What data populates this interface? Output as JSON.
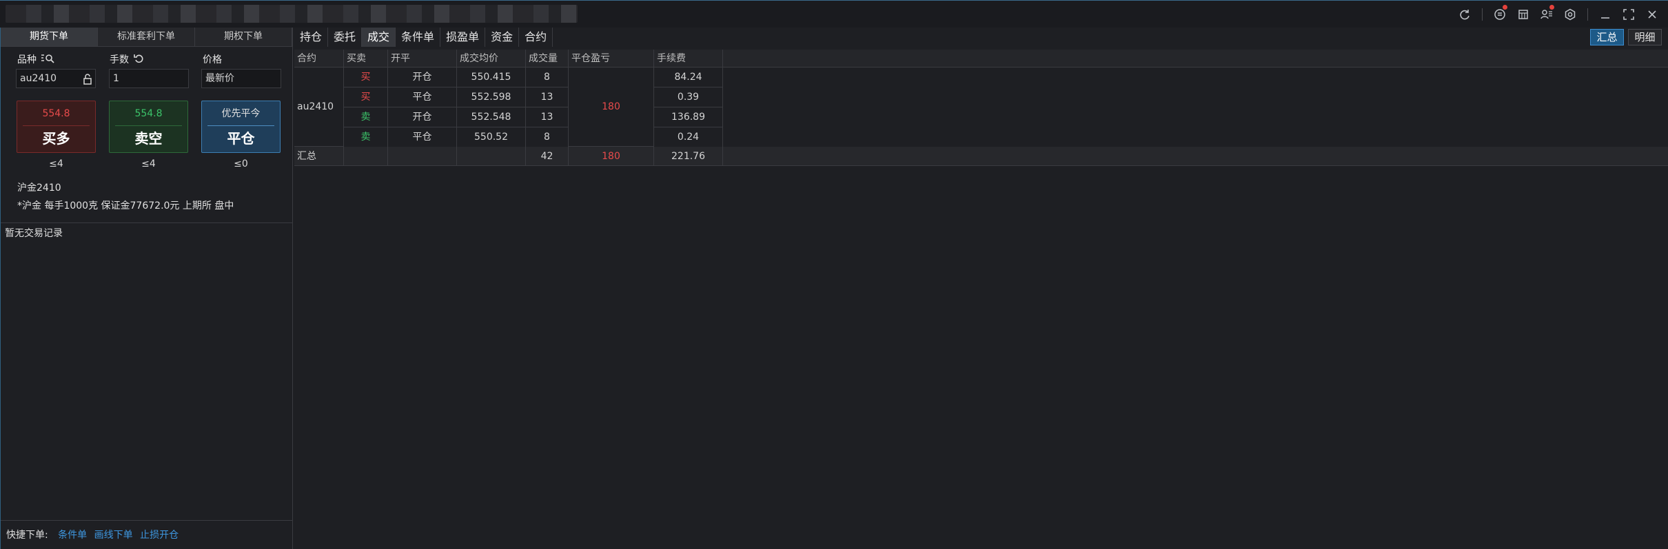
{
  "window": {
    "icons": [
      "refresh-icon",
      "message-icon",
      "calendar-icon",
      "user-list-icon",
      "settings-icon",
      "minimize-icon",
      "maximize-icon",
      "close-icon"
    ]
  },
  "left": {
    "tabs": [
      "期货下单",
      "标准套利下单",
      "期权下单"
    ],
    "product_label": "品种",
    "lots_label": "手数",
    "price_label": "价格",
    "product_value": "au2410",
    "lots_value": "1",
    "price_value": "最新价",
    "buy_price": "554.8",
    "buy_label": "买多",
    "sell_price": "554.8",
    "sell_label": "卖空",
    "close_top": "优先平今",
    "close_label": "平仓",
    "buy_limit": "≤4",
    "sell_limit": "≤4",
    "close_limit": "≤0",
    "contract_name": "沪金2410",
    "contract_info": "*沪金 每手1000克 保证金77672.0元 上期所 盘中",
    "no_records": "暂无交易记录",
    "quick_label": "快捷下单:",
    "quick_links": [
      "条件单",
      "画线下单",
      "止损开仓"
    ]
  },
  "right": {
    "tabs": [
      "持仓",
      "委托",
      "成交",
      "条件单",
      "损盈单",
      "资金",
      "合约"
    ],
    "active_tab": "成交",
    "summary_btn": "汇总",
    "detail_btn": "明细",
    "headers": [
      "合约",
      "买卖",
      "开平",
      "成交均价",
      "成交量",
      "平仓盈亏",
      "手续费"
    ],
    "contract": "au2410",
    "close_pnl": "180",
    "rows": [
      {
        "side": "买",
        "open_close": "开仓",
        "avg_price": "550.415",
        "qty": "8",
        "fee": "84.24"
      },
      {
        "side": "买",
        "open_close": "平仓",
        "avg_price": "552.598",
        "qty": "13",
        "fee": "0.39"
      },
      {
        "side": "卖",
        "open_close": "开仓",
        "avg_price": "552.548",
        "qty": "13",
        "fee": "136.89"
      },
      {
        "side": "卖",
        "open_close": "平仓",
        "avg_price": "550.52",
        "qty": "8",
        "fee": "0.24"
      }
    ],
    "summary": {
      "label": "汇总",
      "qty": "42",
      "pnl": "180",
      "fee": "221.76"
    }
  },
  "colors": {
    "buy": "#e84b4b",
    "sell": "#3cc46a",
    "accent": "#3d8fd0"
  }
}
